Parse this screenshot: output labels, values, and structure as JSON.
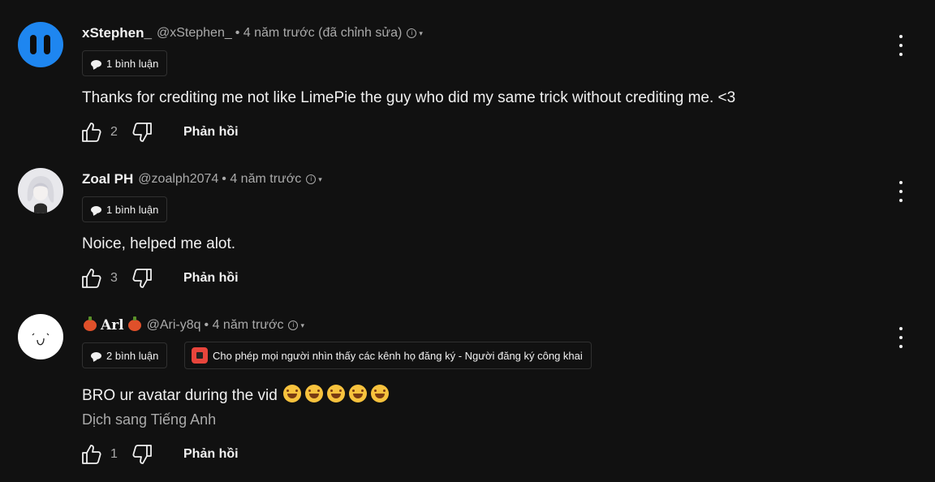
{
  "comments": [
    {
      "author": "xStephen_",
      "handle": "@xStephen_",
      "meta": "• 4 năm trước (đã chỉnh sửa)",
      "reply_count_label": "1 bình luận",
      "text": "Thanks for crediting me not like LimePie the guy who did my same trick without crediting me. <3",
      "likes": "2",
      "reply_label": "Phản hồi",
      "avatar_icon": "pause-icon-avatar"
    },
    {
      "author": "Zoal PH",
      "handle": "@zoalph2074",
      "meta": "• 4 năm trước",
      "reply_count_label": "1 bình luận",
      "text": "Noice, helped me alot.",
      "likes": "3",
      "reply_label": "Phản hồi",
      "avatar_icon": "anime-girl-avatar"
    },
    {
      "author": "Arl",
      "handle": "@Ari-y8q",
      "meta": "• 4 năm trước",
      "reply_count_label": "2 bình luận",
      "public_subs_label": "Cho phép mọi người nhìn thấy các kênh họ đăng ký - Người đăng ký công khai",
      "text": "BRO ur avatar during the vid",
      "translate_label": "Dịch sang Tiếng Anh",
      "likes": "1",
      "reply_label": "Phản hồi",
      "avatar_icon": "smiley-face-avatar",
      "emoji_icon": "laughing-crying-emoji"
    }
  ],
  "colors": {
    "background": "#111111",
    "text_primary": "#f1f1f1",
    "text_secondary": "#aaaaaa",
    "avatar_blue": "#1e86f0",
    "youtube_red": "#e8453c"
  }
}
